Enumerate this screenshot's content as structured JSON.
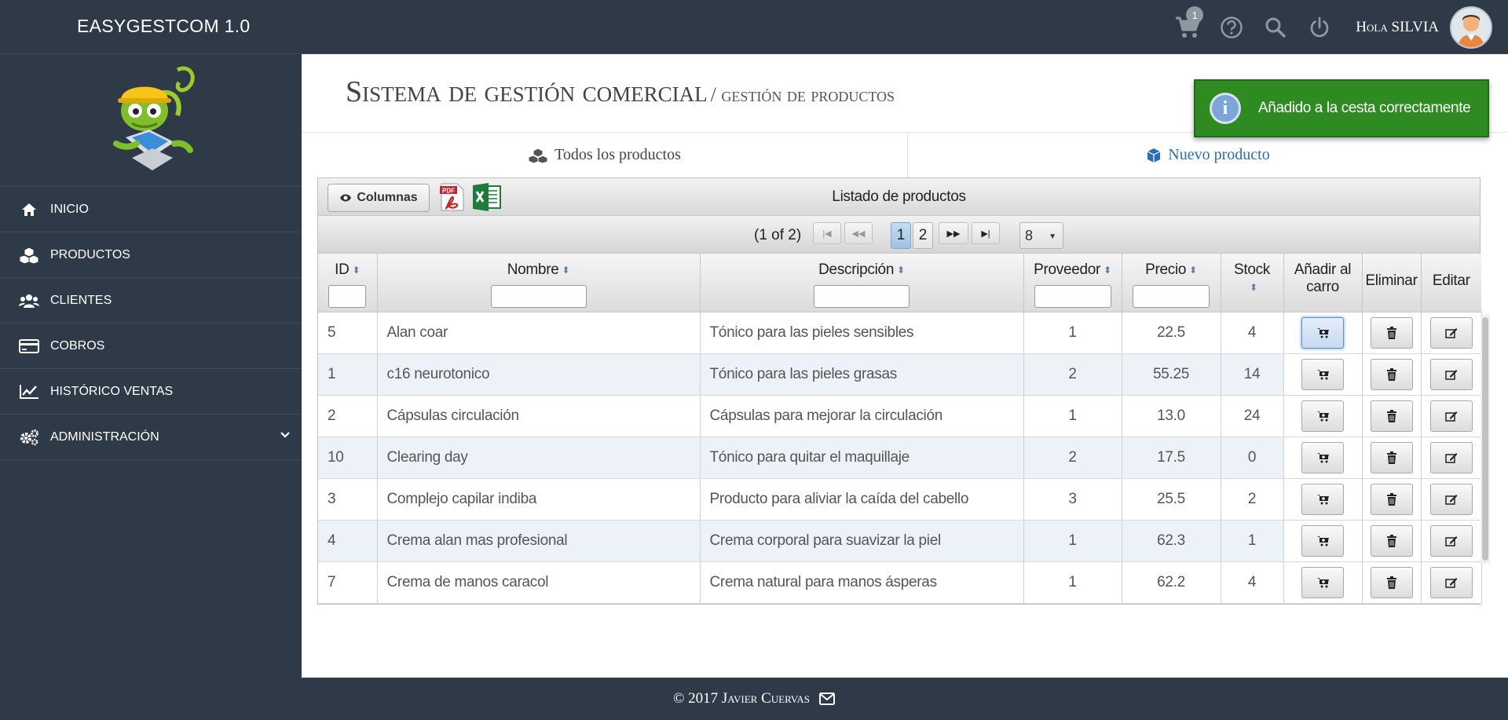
{
  "app": {
    "brand": "EASYGESTCOM 1.0"
  },
  "topbar": {
    "cart_count": "1",
    "greeting": "Hola SILVIA",
    "icons": [
      "cart-icon",
      "help-icon",
      "search-icon",
      "power-icon"
    ]
  },
  "sidebar": {
    "items": [
      {
        "label": "Inicio",
        "icon": "home-icon"
      },
      {
        "label": "Productos",
        "icon": "cubes-icon"
      },
      {
        "label": "Clientes",
        "icon": "users-icon"
      },
      {
        "label": "Cobros",
        "icon": "credit-card-icon"
      },
      {
        "label": "Histórico ventas",
        "icon": "line-chart-icon"
      },
      {
        "label": "Administración",
        "icon": "gears-icon"
      }
    ]
  },
  "header": {
    "title": "Sistema de gestión comercial",
    "subtitle": "/ gestión de productos"
  },
  "tabs": [
    {
      "label": "Todos los productos",
      "icon": "cubes-icon"
    },
    {
      "label": "Nuevo producto",
      "icon": "cube-icon"
    }
  ],
  "grid": {
    "columns_button": "Columnas",
    "caption": "Listado de productos",
    "paginator": {
      "current": "(1 of 2)",
      "pages": [
        "1",
        "2"
      ],
      "active_page": "1",
      "rows_per_page": "8"
    },
    "headers": {
      "id": "ID",
      "nombre": "Nombre",
      "descripcion": "Descripción",
      "proveedor": "Proveedor",
      "precio": "Precio",
      "stock": "Stock",
      "carro_1": "Añadir al",
      "carro_2": "carro",
      "eliminar": "Eliminar",
      "editar": "Editar"
    },
    "rows": [
      {
        "id": "5",
        "nombre": "Alan coar",
        "descripcion": "Tónico para las pieles sensibles",
        "proveedor": "1",
        "precio": "22.5",
        "stock": "4"
      },
      {
        "id": "1",
        "nombre": "c16 neurotonico",
        "descripcion": "Tónico para las pieles grasas",
        "proveedor": "2",
        "precio": "55.25",
        "stock": "14"
      },
      {
        "id": "2",
        "nombre": "Cápsulas circulación",
        "descripcion": "Cápsulas para mejorar la circulación",
        "proveedor": "1",
        "precio": "13.0",
        "stock": "24"
      },
      {
        "id": "10",
        "nombre": "Clearing day",
        "descripcion": "Tónico para quitar el maquillaje",
        "proveedor": "2",
        "precio": "17.5",
        "stock": "0"
      },
      {
        "id": "3",
        "nombre": "Complejo capilar indiba",
        "descripcion": "Producto para aliviar la caída del cabello",
        "proveedor": "3",
        "precio": "25.5",
        "stock": "2"
      },
      {
        "id": "4",
        "nombre": "Crema alan mas profesional",
        "descripcion": "Crema corporal para suavizar la piel",
        "proveedor": "1",
        "precio": "62.3",
        "stock": "1"
      },
      {
        "id": "7",
        "nombre": "Crema de manos caracol",
        "descripcion": "Crema natural para manos ásperas",
        "proveedor": "1",
        "precio": "62.2",
        "stock": "4"
      }
    ]
  },
  "toast": {
    "message": "Añadido a la cesta correctamente",
    "icon": "info-icon"
  },
  "footer": {
    "text": "© 2017 Javier Cuervas",
    "icon": "envelope-icon"
  },
  "colors": {
    "navy": "#2e3a47",
    "toast_green": "#2e8b22",
    "link_blue": "#2a6eb5"
  }
}
